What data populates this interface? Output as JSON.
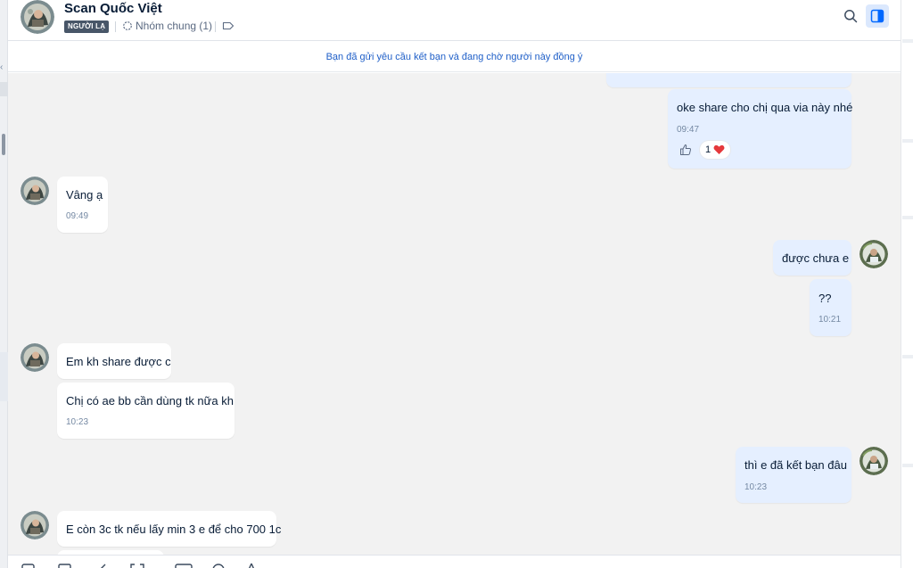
{
  "header": {
    "contact_name": "Scan Quốc Việt",
    "stranger_badge": "NGƯỜI LẠ",
    "common_group": "Nhóm chung (1)"
  },
  "notice": "Bạn đã gửi yêu cầu kết bạn và đang chờ người này đồng ý",
  "messages": [
    {
      "id": "m1",
      "dir": "out",
      "text": "oke share cho chị qua via này nhé",
      "time": "09:47",
      "reaction_count": "1"
    },
    {
      "id": "m2",
      "dir": "in",
      "text": "Vâng ạ",
      "time": "09:49"
    },
    {
      "id": "m3",
      "dir": "out",
      "text": "được chưa e"
    },
    {
      "id": "m4",
      "dir": "out",
      "text": "??",
      "time": "10:21"
    },
    {
      "id": "m5",
      "dir": "in",
      "text": "Em kh share được c"
    },
    {
      "id": "m6",
      "dir": "in",
      "text": "Chị có ae bb cần dùng tk nữa kh",
      "time": "10:23"
    },
    {
      "id": "m7",
      "dir": "out",
      "text": "thì e đã kết bạn đâu",
      "time": "10:23"
    },
    {
      "id": "m8",
      "dir": "in",
      "text": "E còn 3c tk nếu lấy min 3 e để cho 700 1c"
    }
  ],
  "colors": {
    "accent": "#1f5fc8",
    "outgoing_bubble": "#e5efff",
    "incoming_bubble": "#ffffff",
    "chat_background": "#f2f2f2",
    "heart": "#e5383b"
  },
  "icons": {
    "search": "search-icon",
    "sidebar_toggle": "sidebar-toggle-icon",
    "group": "group-icon",
    "tag": "tag-icon",
    "like": "thumbs-up-icon",
    "heart": "heart-icon"
  }
}
